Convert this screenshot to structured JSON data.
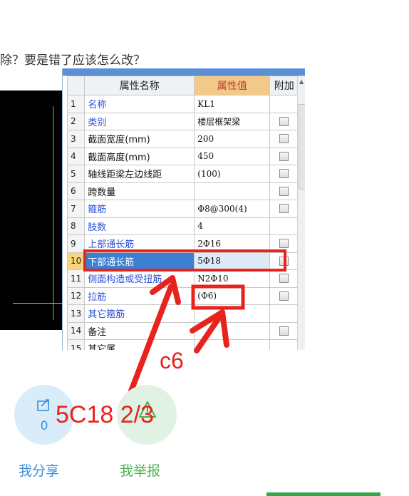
{
  "question_text": "除？要是错了应该怎么改？",
  "properties_panel": {
    "headers": {
      "num": "",
      "name": "属性名称",
      "value": "属性值",
      "add": "附加"
    },
    "rows": [
      {
        "num": "1",
        "name": "名称",
        "value": "KL1",
        "color": "blue",
        "checkbox": false
      },
      {
        "num": "2",
        "name": "类别",
        "value": "楼层框架梁",
        "color": "blue",
        "checkbox": true
      },
      {
        "num": "3",
        "name": "截面宽度(mm)",
        "value": "200",
        "color": "black",
        "checkbox": true
      },
      {
        "num": "4",
        "name": "截面高度(mm)",
        "value": "450",
        "color": "black",
        "checkbox": true
      },
      {
        "num": "5",
        "name": "轴线距梁左边线距",
        "value": "(100)",
        "color": "black",
        "checkbox": true
      },
      {
        "num": "6",
        "name": "跨数量",
        "value": "",
        "color": "black",
        "checkbox": true
      },
      {
        "num": "7",
        "name": "箍筋",
        "value": "Φ8@300(4)",
        "color": "blue",
        "checkbox": true
      },
      {
        "num": "8",
        "name": "肢数",
        "value": "4",
        "color": "blue",
        "checkbox": false
      },
      {
        "num": "9",
        "name": "上部通长筋",
        "value": "2Φ16",
        "color": "blue",
        "checkbox": true
      },
      {
        "num": "10",
        "name": "下部通长筋",
        "value": "5Φ18",
        "color": "blue",
        "checkbox": true,
        "selected": true
      },
      {
        "num": "11",
        "name": "侧面构造或受扭筋",
        "value": "N2Φ10",
        "color": "blue",
        "checkbox": true
      },
      {
        "num": "12",
        "name": "拉筋",
        "value": "(Φ6)",
        "color": "blue",
        "checkbox": true
      },
      {
        "num": "13",
        "name": "其它箍筋",
        "value": "",
        "color": "blue",
        "checkbox": false
      },
      {
        "num": "14",
        "name": "备注",
        "value": "",
        "color": "black",
        "checkbox": true
      },
      {
        "num": "15",
        "name": "其它属",
        "value": "",
        "color": "black",
        "checkbox": false
      }
    ]
  },
  "annotations": {
    "c6": "c6",
    "correction": "5C18 2/3"
  },
  "actions": {
    "share_count": "0",
    "share_label": "我分享",
    "report_label": "我举报"
  },
  "colors": {
    "annotation_red": "#e8231e",
    "share_blue": "#3a8fd6",
    "report_green": "#4caf50"
  }
}
